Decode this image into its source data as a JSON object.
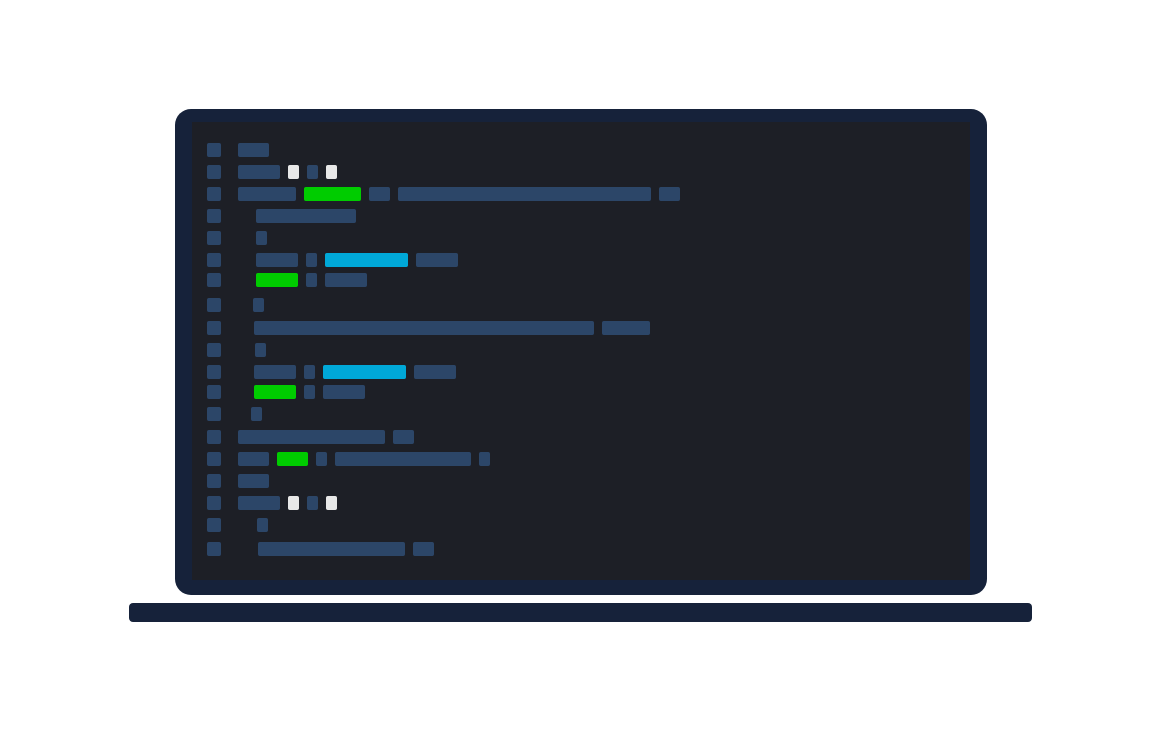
{
  "colors": {
    "frame": "#16223a",
    "screen": "#1d1f26",
    "code_default": "#2c4668",
    "code_keyword": "#00cc00",
    "code_string": "#00a8d8",
    "code_punct": "#e8e8e8"
  },
  "code_lines": [
    [
      {
        "w": 31,
        "k": "default"
      }
    ],
    [
      {
        "w": 42,
        "k": "default"
      },
      {
        "w": 11,
        "k": "punct"
      },
      {
        "w": 11,
        "k": "default"
      },
      {
        "w": 11,
        "k": "punct"
      }
    ],
    [
      {
        "w": 58,
        "k": "default"
      },
      {
        "w": 57,
        "k": "keyword"
      },
      {
        "w": 21,
        "k": "default"
      },
      {
        "w": 253,
        "k": "default"
      },
      {
        "w": 21,
        "k": "default"
      }
    ],
    [
      {
        "w": 100,
        "k": "default"
      }
    ],
    [
      {
        "w": 11,
        "k": "default"
      }
    ],
    [
      {
        "w": 42,
        "k": "default"
      },
      {
        "w": 11,
        "k": "default"
      },
      {
        "w": 83,
        "k": "string"
      },
      {
        "w": 42,
        "k": "default"
      }
    ],
    [
      {
        "w": 42,
        "k": "keyword"
      },
      {
        "w": 11,
        "k": "default"
      },
      {
        "w": 42,
        "k": "default"
      }
    ],
    [
      {
        "w": 11,
        "k": "default"
      }
    ],
    [
      {
        "w": 340,
        "k": "default"
      },
      {
        "w": 48,
        "k": "default"
      }
    ],
    [
      {
        "w": 11,
        "k": "default"
      }
    ],
    [
      {
        "w": 42,
        "k": "default"
      },
      {
        "w": 11,
        "k": "default"
      },
      {
        "w": 83,
        "k": "string"
      },
      {
        "w": 42,
        "k": "default"
      }
    ],
    [
      {
        "w": 42,
        "k": "keyword"
      },
      {
        "w": 11,
        "k": "default"
      },
      {
        "w": 42,
        "k": "default"
      }
    ],
    [
      {
        "w": 11,
        "k": "default"
      }
    ],
    [
      {
        "w": 147,
        "k": "default"
      },
      {
        "w": 21,
        "k": "default"
      }
    ],
    [
      {
        "w": 31,
        "k": "default"
      },
      {
        "w": 31,
        "k": "keyword"
      },
      {
        "w": 11,
        "k": "default"
      },
      {
        "w": 136,
        "k": "default"
      },
      {
        "w": 11,
        "k": "default"
      }
    ],
    [
      {
        "w": 31,
        "k": "default"
      }
    ],
    [
      {
        "w": 42,
        "k": "default"
      },
      {
        "w": 11,
        "k": "punct"
      },
      {
        "w": 11,
        "k": "default"
      },
      {
        "w": 11,
        "k": "punct"
      }
    ],
    [
      {
        "w": 11,
        "k": "default"
      }
    ],
    [
      {
        "w": 147,
        "k": "default"
      },
      {
        "w": 21,
        "k": "default"
      }
    ]
  ]
}
